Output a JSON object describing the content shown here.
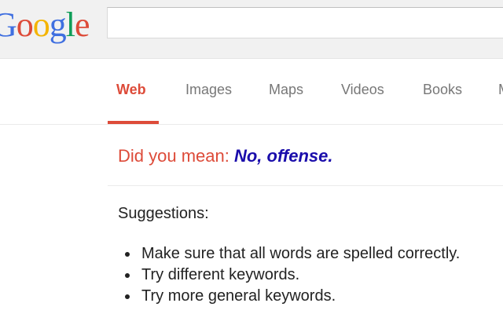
{
  "logo": {
    "letters": [
      {
        "char": "o",
        "color": "#dd4b39"
      },
      {
        "char": "o",
        "color": "#f4b400"
      },
      {
        "char": "g",
        "color": "#3f6fe0"
      },
      {
        "char": "l",
        "color": "#0f9d58"
      },
      {
        "char": "e",
        "color": "#dd4b39"
      }
    ],
    "first_letter": "G",
    "first_color": "#3f6fe0"
  },
  "search": {
    "value": ""
  },
  "tabs": [
    {
      "label": "Web",
      "active": true
    },
    {
      "label": "Images",
      "active": false
    },
    {
      "label": "Maps",
      "active": false
    },
    {
      "label": "Videos",
      "active": false
    },
    {
      "label": "Books",
      "active": false
    },
    {
      "label": "M",
      "active": false
    }
  ],
  "spelling": {
    "prefix": "Did you mean: ",
    "suggestion": "No, offense."
  },
  "suggestions": {
    "title": "Suggestions:",
    "items": [
      "Make sure that all words are spelled correctly.",
      "Try different keywords.",
      "Try more general keywords."
    ]
  },
  "colors": {
    "accent": "#dd4b39",
    "link": "#1a0dab",
    "tab_text": "#777777",
    "topbar": "#f1f1f1"
  }
}
